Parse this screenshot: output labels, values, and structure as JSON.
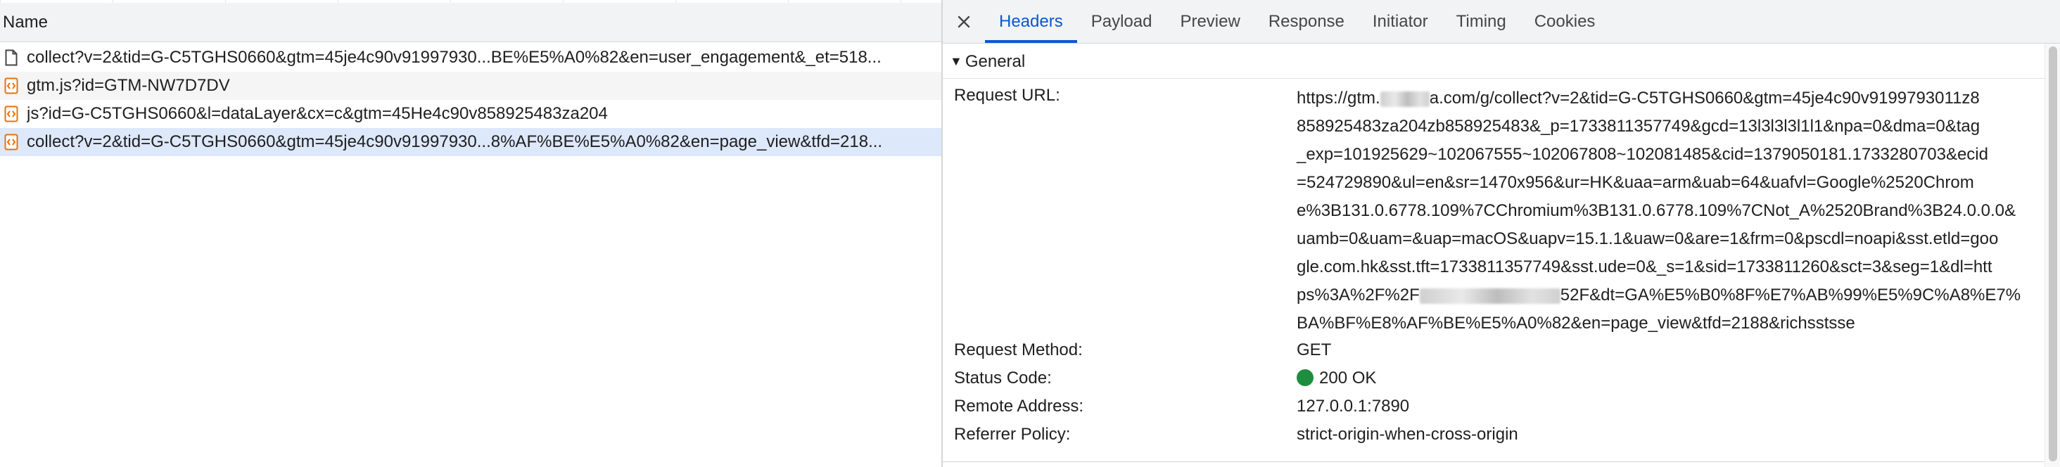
{
  "list": {
    "column_name": "Name",
    "requests": [
      {
        "name": "collect?v=2&tid=G-C5TGHS0660&gtm=45je4c90v91997930...BE%E5%A0%82&en=user_engagement&_et=518...",
        "icon": "document-icon"
      },
      {
        "name": "gtm.js?id=GTM-NW7D7DV",
        "icon": "script-icon"
      },
      {
        "name": "js?id=G-C5TGHS0660&l=dataLayer&cx=c&gtm=45He4c90v858925483za204",
        "icon": "script-icon"
      },
      {
        "name": "collect?v=2&tid=G-C5TGHS0660&gtm=45je4c90v91997930...8%AF%BE%E5%A0%82&en=page_view&tfd=218...",
        "icon": "script-icon"
      }
    ]
  },
  "details": {
    "close_icon": "close-icon",
    "tabs": [
      "Headers",
      "Payload",
      "Preview",
      "Response",
      "Initiator",
      "Timing",
      "Cookies"
    ],
    "active_tab": "Headers",
    "general": {
      "title": "General",
      "request_url_label": "Request URL:",
      "request_url_lines": [
        [
          "https://gtm.",
          "a.com/g/collect?v=2&tid=G-C5TGHS0660&gtm=45je4c90v9199793011z8"
        ],
        [
          "858925483za204zb858925483&_p=1733811357749&gcd=13l3l3l3l1l1&npa=0&dma=0&tag"
        ],
        [
          "_exp=101925629~102067555~102067808~102081485&cid=1379050181.1733280703&ecid"
        ],
        [
          "=524729890&ul=en&sr=1470x956&ur=HK&uaa=arm&uab=64&uafvl=Google%2520Chrom"
        ],
        [
          "e%3B131.0.6778.109%7CChromium%3B131.0.6778.109%7CNot_A%2520Brand%3B24.0.0.0&"
        ],
        [
          "uamb=0&uam=&uap=macOS&uapv=15.1.1&uaw=0&are=1&frm=0&pscdl=noapi&sst.etld=goo"
        ],
        [
          "gle.com.hk&sst.tft=1733811357749&sst.ude=0&_s=1&sid=1733811260&sct=3&seg=1&dl=htt"
        ],
        [
          "ps%3A%2F%2F",
          "52F&dt=GA%E5%B0%8F%E7%AB%99%E5%9C%A8%E7%"
        ],
        [
          "BA%BF%E8%AF%BE%E5%A0%82&en=page_view&tfd=2188&richsstsse"
        ]
      ],
      "request_method_label": "Request Method:",
      "request_method": "GET",
      "status_code_label": "Status Code:",
      "status_code": "200 OK",
      "status_color": "#1e8e3e",
      "remote_address_label": "Remote Address:",
      "remote_address": "127.0.0.1:7890",
      "referrer_policy_label": "Referrer Policy:",
      "referrer_policy": "strict-origin-when-cross-origin"
    }
  },
  "colors": {
    "accent": "#0b57d0",
    "selected_row": "#dde8fb",
    "script_icon": "#e8710a"
  }
}
